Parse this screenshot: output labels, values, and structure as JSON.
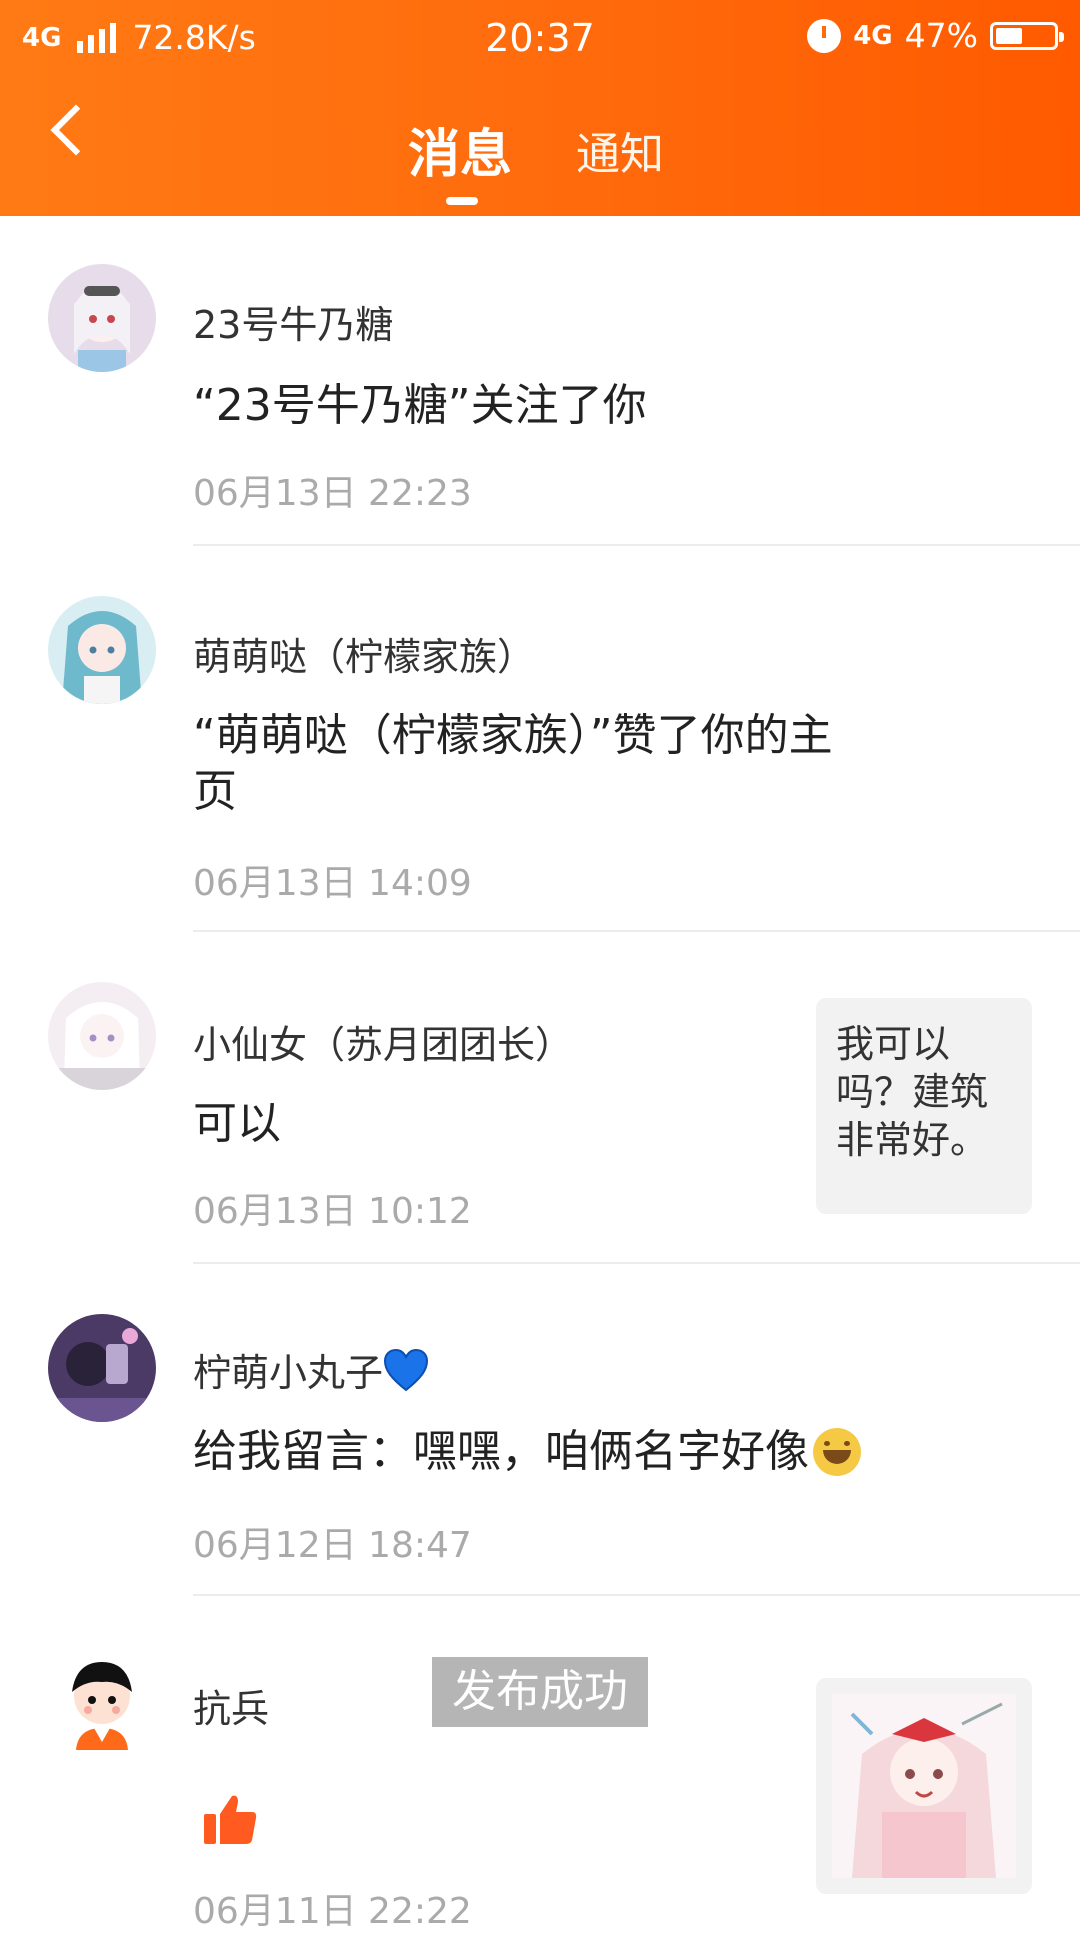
{
  "status_bar": {
    "network": "4G",
    "speed": "72.8K/s",
    "time": "20:37",
    "network2": "4G",
    "battery": "47%",
    "battery_level": 0.47
  },
  "header": {
    "tab_messages": "消息",
    "tab_notifications": "通知"
  },
  "messages": [
    {
      "name": "23号牛乃糖",
      "text": "“23号牛乃糖”关注了你",
      "date": "06月13日 22:23"
    },
    {
      "name": "萌萌哒（柠檬家族）",
      "text_line1": "“萌萌哒（柠檬家族）”赞了你的主",
      "text_line2": "页",
      "date": "06月13日 14:09"
    },
    {
      "name": "小仙女（苏月团团长）",
      "text": "可以",
      "date": "06月13日 10:12",
      "quote": "我可以吗？建筑非常好。"
    },
    {
      "name": "柠萌小丸子",
      "text": "给我留言：嘿嘿，咱俩名字好像",
      "date": "06月12日 18:47"
    },
    {
      "name": "抗兵",
      "date": "06月11日 22:22"
    }
  ],
  "toast": "发布成功",
  "colors": {
    "header_start": "#ff7a14",
    "header_end": "#ff5a00",
    "thumb_icon": "#ff5a1f",
    "heart": "#1a73e8"
  }
}
